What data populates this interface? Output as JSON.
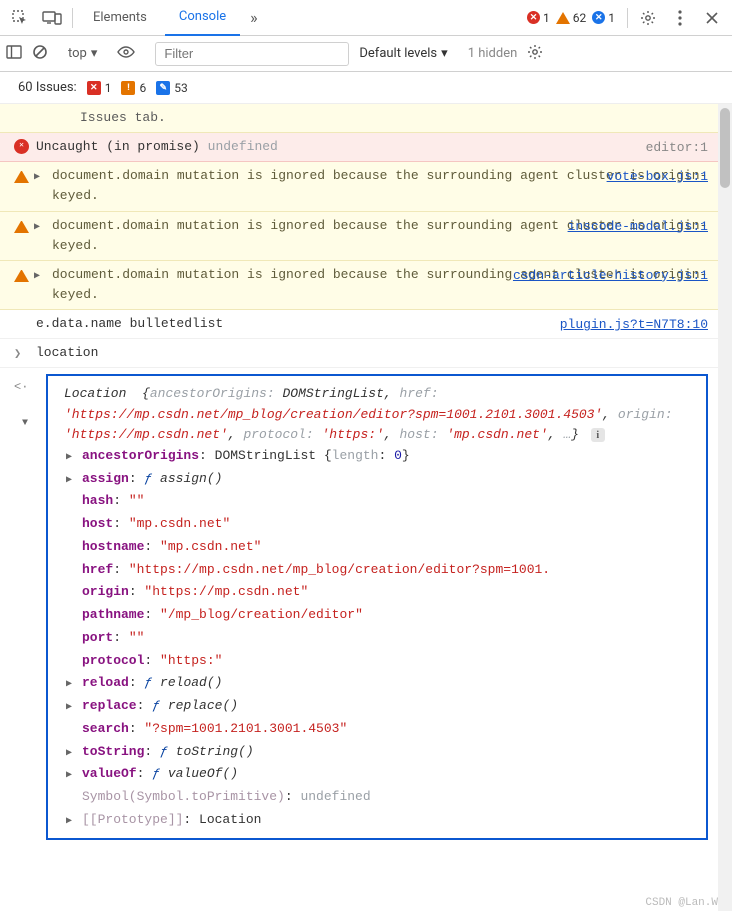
{
  "topbar": {
    "tabs": {
      "elements": "Elements",
      "console": "Console"
    },
    "more": "»",
    "error_count": "1",
    "warn_count": "62",
    "blue_count": "1"
  },
  "toolbar": {
    "context": "top",
    "filter_placeholder": "Filter",
    "levels": "Default levels",
    "hidden": "1 hidden"
  },
  "issues": {
    "label": "60 Issues:",
    "red": "1",
    "orange": "6",
    "blue": "53"
  },
  "rows": {
    "frag": "Issues tab.",
    "err": {
      "msg": "Uncaught (in promise) ",
      "undef": "undefined",
      "src": "editor:1"
    },
    "w1": {
      "msg": "document.domain mutation is ignored because the surrounding agent cluster is origin-keyed.",
      "src": "vote-box.js:1"
    },
    "w2": {
      "msg": "document.domain mutation is ignored because the surrounding agent cluster is origin-keyed.",
      "src": "inscode-modal.js:1"
    },
    "w3": {
      "msg": "document.domain mutation is ignored because the surrounding agent cluster is origin-keyed.",
      "src": "csdn-article-history.js:1"
    },
    "log": {
      "msg": "e.data.name bulletedlist",
      "src": "plugin.js?t=N7T8:10"
    },
    "input": "location"
  },
  "location_obj": {
    "head_type": "Location",
    "head_frags": {
      "ancestorOrigins": "DOMStringList",
      "href": "'https://mp.csdn.net/mp_blog/creation/editor?spm=1001.2101.3001.4503'",
      "origin": "'https://mp.csdn.net'",
      "protocol": "'https:'",
      "host": "'mp.csdn.net'",
      "ell": "…"
    },
    "ancestorOrigins": {
      "type": "DOMStringList",
      "length_key": "length",
      "length_val": "0"
    },
    "assign": "assign()",
    "hash": "\"\"",
    "host": "\"mp.csdn.net\"",
    "hostname": "\"mp.csdn.net\"",
    "href": "\"https://mp.csdn.net/mp_blog/creation/editor?spm=1001.",
    "origin": "\"https://mp.csdn.net\"",
    "pathname": "\"/mp_blog/creation/editor\"",
    "port": "\"\"",
    "protocol": "\"https:\"",
    "reload": "reload()",
    "replace": "replace()",
    "search": "\"?spm=1001.2101.3001.4503\"",
    "toString": "toString()",
    "valueOf": "valueOf()",
    "symbol_key": "Symbol(Symbol.toPrimitive)",
    "symbol_val": "undefined",
    "proto_key": "[[Prototype]]",
    "proto_val": "Location"
  },
  "watermark": "CSDN @Lan.W"
}
